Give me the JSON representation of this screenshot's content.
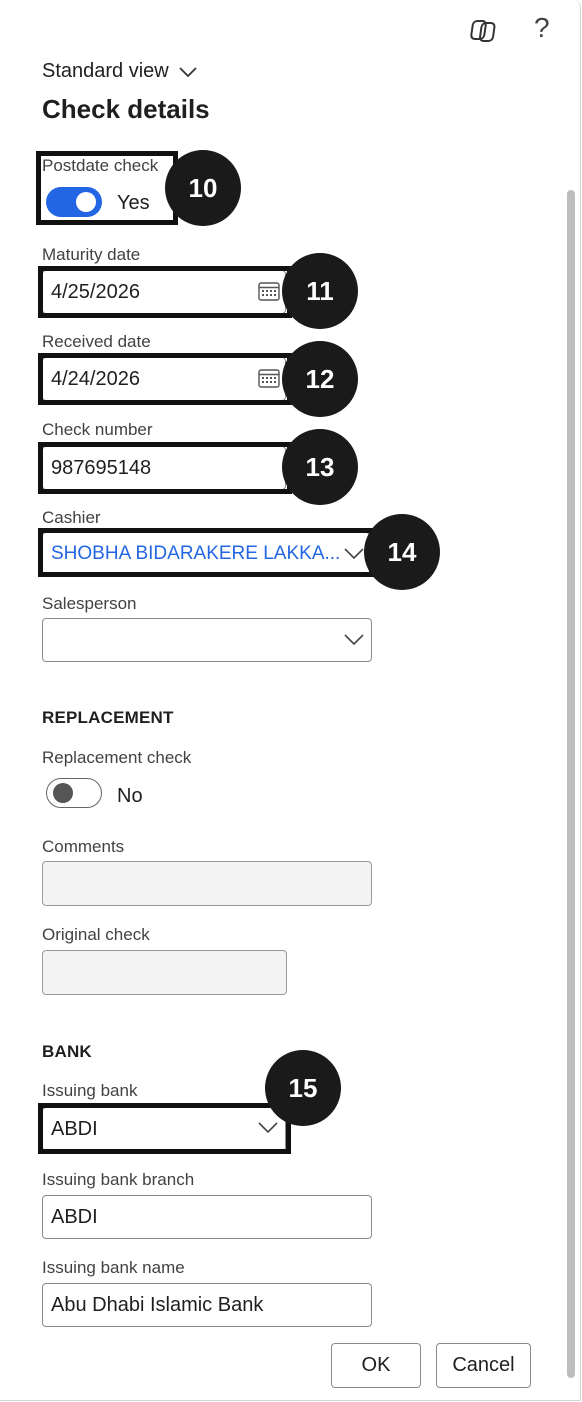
{
  "header": {
    "copilot_icon": "copilot-icon",
    "help_label": "?",
    "view_label": "Standard view",
    "title": "Check details"
  },
  "check": {
    "postdate_label": "Postdate check",
    "postdate_value": "Yes",
    "maturity_label": "Maturity date",
    "maturity_value": "4/25/2026",
    "received_label": "Received date",
    "received_value": "4/24/2026",
    "check_number_label": "Check number",
    "check_number_value": "987695148",
    "cashier_label": "Cashier",
    "cashier_value": "SHOBHA BIDARAKERE LAKKA...",
    "salesperson_label": "Salesperson",
    "salesperson_value": ""
  },
  "replacement": {
    "section_title": "REPLACEMENT",
    "replacement_label": "Replacement check",
    "replacement_value": "No",
    "comments_label": "Comments",
    "comments_value": "",
    "original_label": "Original check",
    "original_value": ""
  },
  "bank": {
    "section_title": "BANK",
    "issuing_bank_label": "Issuing bank",
    "issuing_bank_value": "ABDI",
    "branch_label": "Issuing bank branch",
    "branch_value": "ABDI",
    "name_label": "Issuing bank name",
    "name_value": "Abu Dhabi Islamic Bank"
  },
  "badges": [
    "10",
    "11",
    "12",
    "13",
    "14",
    "15"
  ],
  "footer": {
    "ok_label": "OK",
    "cancel_label": "Cancel"
  },
  "colors": {
    "accent": "#2266e3",
    "badge": "#1a1a1a",
    "highlight_border": "#111111"
  }
}
